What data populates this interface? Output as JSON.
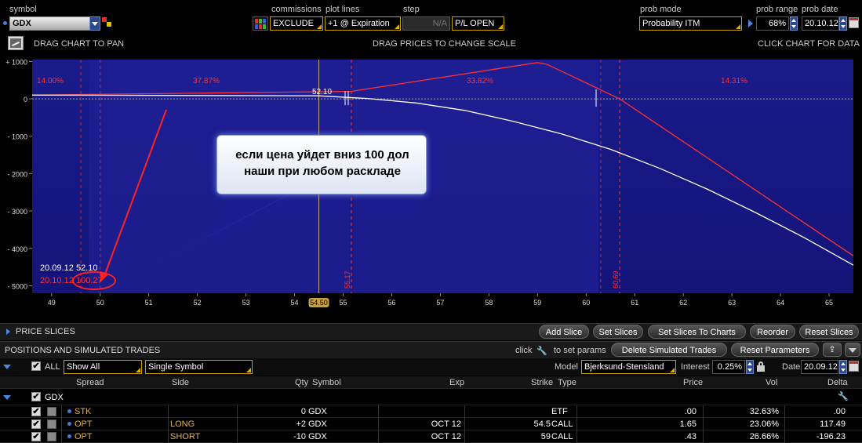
{
  "toolbar": {
    "symbol_label": "symbol",
    "symbol_value": "GDX",
    "commissions_label": "commissions",
    "commissions_value": "EXCLUDE",
    "plot_lines_label": "plot lines",
    "plot_lines_value": "+1 @ Expiration",
    "step_label": "step",
    "step_value": "N/A",
    "pl_value": "P/L OPEN",
    "prob_mode_label": "prob mode",
    "prob_mode_value": "Probability ITM",
    "prob_range_label": "prob range",
    "prob_range_value": "68%",
    "prob_date_label": "prob date",
    "prob_date_value": "20.10.12"
  },
  "chart_hints": {
    "pan": "DRAG CHART TO PAN",
    "scale": "DRAG PRICES TO CHANGE SCALE",
    "data": "CLICK CHART FOR DATA"
  },
  "chart_data": {
    "type": "line",
    "x_ticks": [
      "49",
      "50",
      "51",
      "52",
      "53",
      "54",
      "55",
      "56",
      "57",
      "58",
      "59",
      "60",
      "61",
      "62",
      "63",
      "64",
      "65"
    ],
    "y_ticks": [
      "+ 1000",
      "0",
      "- 1000",
      "- 2000",
      "- 3000",
      "- 4000",
      "- 5000"
    ],
    "xlim": [
      48.6,
      65.5
    ],
    "ylim": [
      -5200,
      1050
    ],
    "current_price_label": "52.10",
    "cursor_price_label": "54.50",
    "breakeven_labels": [
      {
        "value": 55.17,
        "text": "55.17"
      },
      {
        "value": 60.69,
        "text": "60.69"
      }
    ],
    "prob_zones": [
      "14.00%",
      "37.87%",
      "33.82%",
      "14.31%"
    ],
    "series": [
      {
        "color": "#ff3030",
        "x": [
          48.6,
          55.17,
          59.0,
          59.2,
          60.69,
          65.5
        ],
        "y": [
          100,
          200,
          970,
          920,
          0,
          -4200
        ]
      },
      {
        "color": "#ffffff",
        "x": [
          48.6,
          54.5,
          55.5,
          56.5,
          57.5,
          58.5,
          59.5,
          60.5,
          61.5,
          62.5,
          63.5,
          64.5,
          65.5
        ],
        "y": [
          100,
          80,
          10,
          -110,
          -310,
          -600,
          -940,
          -1350,
          -1850,
          -2420,
          -3050,
          -3720,
          -4450
        ]
      }
    ],
    "readout": {
      "date1": "20.09.12",
      "price1": "52.10",
      "date2": "20.10.12",
      "price2": "100.27"
    }
  },
  "annotation": {
    "line1": "если цена уйдет вниз 100 дол",
    "line2": "наши при любом раскладе"
  },
  "price_slices": {
    "title": "PRICE SLICES",
    "buttons": [
      "Add Slice",
      "Set Slices",
      "Set Slices To Charts",
      "Reorder",
      "Reset Slices"
    ]
  },
  "positions": {
    "title": "POSITIONS AND SIMULATED TRADES",
    "click_hint_pre": "click",
    "click_hint_post": "to set params",
    "delete_btn": "Delete Simulated Trades",
    "reset_btn": "Reset Parameters",
    "all_label": "ALL",
    "show_value": "Show All",
    "symbol_mode": "Single Symbol",
    "model_label": "Model",
    "model_value": "Bjerksund-Stensland",
    "interest_label": "Interest",
    "interest_value": "0.25%",
    "date_label": "Date",
    "date_value": "20.09.12",
    "columns": [
      "Spread",
      "Side",
      "Qty",
      "Symbol",
      "Exp",
      "Strike",
      "Type",
      "Price",
      "Vol",
      "Delta"
    ],
    "group": "GDX",
    "rows": [
      {
        "spread": "STK",
        "side": "",
        "qty": "0",
        "symbol": "GDX",
        "exp": "",
        "strike": "",
        "type": "ETF",
        "price": ".00",
        "vol": "32.63%",
        "delta": ".00"
      },
      {
        "spread": "OPT",
        "side": "LONG",
        "qty": "+2",
        "symbol": "GDX",
        "exp": "OCT 12",
        "strike": "54.5",
        "type": "CALL",
        "price": "1.65",
        "vol": "23.06%",
        "delta": "117.49"
      },
      {
        "spread": "OPT",
        "side": "SHORT",
        "qty": "-10",
        "symbol": "GDX",
        "exp": "OCT 12",
        "strike": "59",
        "type": "CALL",
        "price": ".43",
        "vol": "26.66%",
        "delta": "-196.23"
      }
    ]
  }
}
